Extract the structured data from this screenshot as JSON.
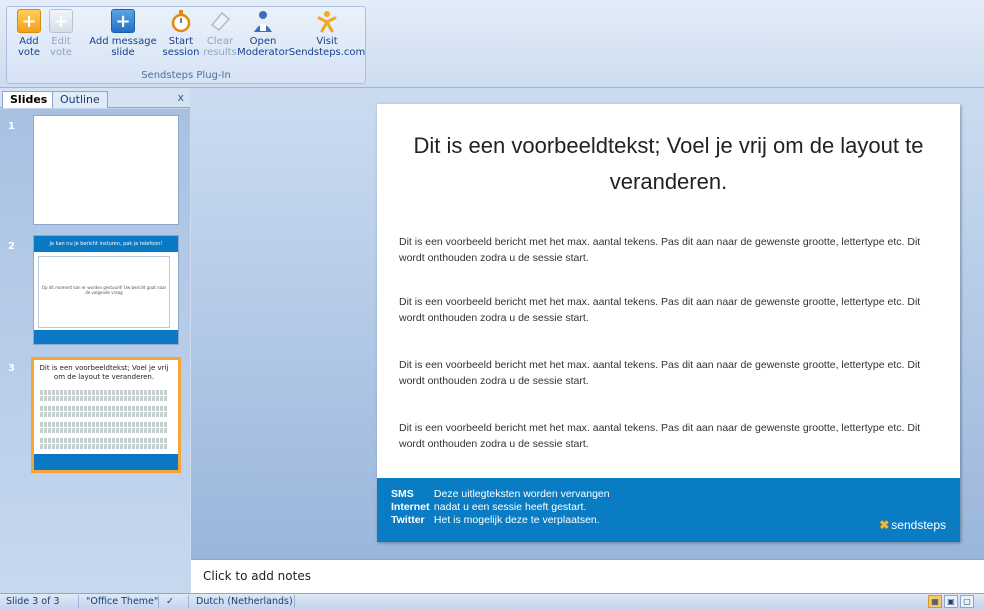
{
  "ribbon": {
    "group_label": "Sendsteps Plug-In",
    "buttons": [
      {
        "label": "Add\nvote",
        "icon": "plus-icon",
        "disabled": false
      },
      {
        "label": "Edit\nvote",
        "icon": "plus-icon",
        "disabled": true
      },
      {
        "label": "Add message\nslide",
        "icon": "plus-icon",
        "disabled": false
      },
      {
        "label": "Start\nsession",
        "icon": "stopwatch-icon",
        "disabled": false
      },
      {
        "label": "Clear\nresults",
        "icon": "eraser-icon",
        "disabled": true
      },
      {
        "label": "Open\nModerator",
        "icon": "moderator-icon",
        "disabled": false
      },
      {
        "label": "Visit\nSendsteps.com",
        "icon": "sendsteps-icon",
        "disabled": false
      }
    ]
  },
  "left_pane": {
    "tabs": [
      "Slides",
      "Outline"
    ],
    "close": "x",
    "slides": [
      {
        "number": "1"
      },
      {
        "number": "2",
        "title": "Je kan nu je bericht insturen,   pak je telefoon!",
        "body": "Op dit moment kan er worden gestuurd! Uw bericht gaat naar de volgende vraag"
      },
      {
        "number": "3",
        "title": "Dit is een voorbeeldtekst; Voel je vrij om de layout te veranderen."
      }
    ]
  },
  "slide": {
    "title": "Dit is een voorbeeldtekst; Voel je vrij om de layout te veranderen.",
    "paragraphs": [
      "Dit is een voorbeeld bericht met het max. aantal tekens. Pas dit aan naar de gewenste grootte, lettertype etc. Dit wordt onthouden  zodra u de sessie start.",
      "Dit is een voorbeeld bericht met het max. aantal tekens. Pas dit aan naar de gewenste grootte, lettertype etc. Dit wordt onthouden  zodra u de sessie start.",
      "Dit is een voorbeeld bericht met het max. aantal tekens. Pas dit aan naar de gewenste grootte, lettertype etc. Dit wordt onthouden  zodra u de sessie start.",
      "Dit is een voorbeeld bericht met het max. aantal tekens. Pas dit aan naar de gewenste grootte, lettertype etc. Dit wordt onthouden  zodra u de sessie start."
    ],
    "footer": [
      {
        "key": "SMS",
        "text": "Deze uitlegteksten worden vervangen"
      },
      {
        "key": "Internet",
        "text": "nadat u een sessie heeft gestart."
      },
      {
        "key": "Twitter",
        "text": "Het is mogelijk deze te verplaatsen."
      }
    ],
    "logo": "sendsteps",
    "footer_color": "#0a7cc4"
  },
  "notes": {
    "placeholder": "Click to add notes"
  },
  "status": {
    "slide": "Slide 3 of 3",
    "theme": "\"Office Theme\"",
    "language": "Dutch (Netherlands)"
  }
}
